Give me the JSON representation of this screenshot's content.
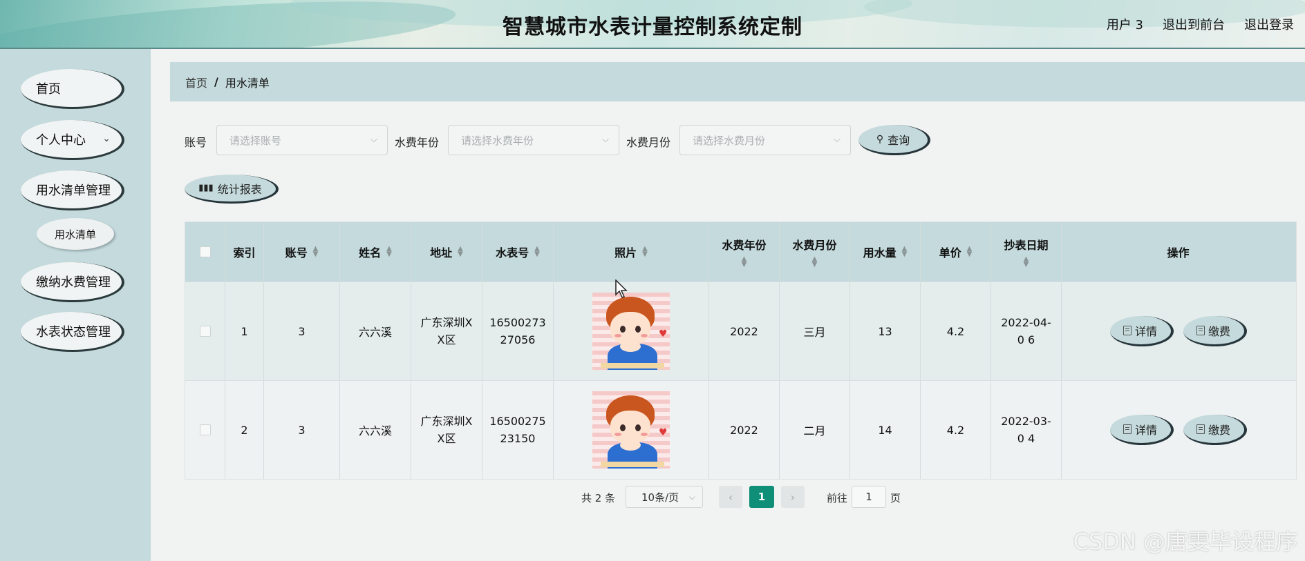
{
  "header": {
    "title": "智慧城市水表计量控制系统定制",
    "user": "用户 3",
    "to_front": "退出到前台",
    "logout": "退出登录"
  },
  "sidebar": {
    "items": [
      {
        "label": "首页"
      },
      {
        "label": "个人中心"
      },
      {
        "label": "用水清单管理"
      },
      {
        "label": "缴纳水费管理"
      },
      {
        "label": "水表状态管理"
      }
    ],
    "sub_item": "用水清单"
  },
  "breadcrumb": {
    "home": "首页",
    "separator": "/",
    "current": "用水清单"
  },
  "filters": {
    "account_label": "账号",
    "account_placeholder": "请选择账号",
    "year_label": "水费年份",
    "year_placeholder": "请选择水费年份",
    "month_label": "水费月份",
    "month_placeholder": "请选择水费月份",
    "query_button": "查询",
    "report_button": "统计报表"
  },
  "table": {
    "headers": {
      "index": "索引",
      "account": "账号",
      "name": "姓名",
      "address": "地址",
      "meter_no": "水表号",
      "photo": "照片",
      "year": "水费年份",
      "month": "水费月份",
      "usage": "用水量",
      "price": "单价",
      "reading_date": "抄表日期",
      "actions": "操作"
    },
    "rows": [
      {
        "index": "1",
        "account": "3",
        "name": "六六溪",
        "address": "广东深圳X X区",
        "meter_no": "16500273 27056",
        "year": "2022",
        "month": "三月",
        "usage": "13",
        "price": "4.2",
        "reading_date": "2022-04-0 6",
        "detail_button": "详情",
        "pay_button": "缴费"
      },
      {
        "index": "2",
        "account": "3",
        "name": "六六溪",
        "address": "广东深圳X X区",
        "meter_no": "16500275 23150",
        "year": "2022",
        "month": "二月",
        "usage": "14",
        "price": "4.2",
        "reading_date": "2022-03-0 4",
        "detail_button": "详情",
        "pay_button": "缴费"
      }
    ]
  },
  "pagination": {
    "total": "共 2 条",
    "page_size": "10条/页",
    "prev": "‹",
    "current_page": "1",
    "next": "›",
    "goto_label": "前往",
    "goto_value": "1",
    "page_suffix": "页"
  },
  "watermark": "CSDN @唐雯毕设程序",
  "colors": {
    "accent": "#c5dadc",
    "active_page": "#0f8f78",
    "button_shadow": "#26353a"
  }
}
